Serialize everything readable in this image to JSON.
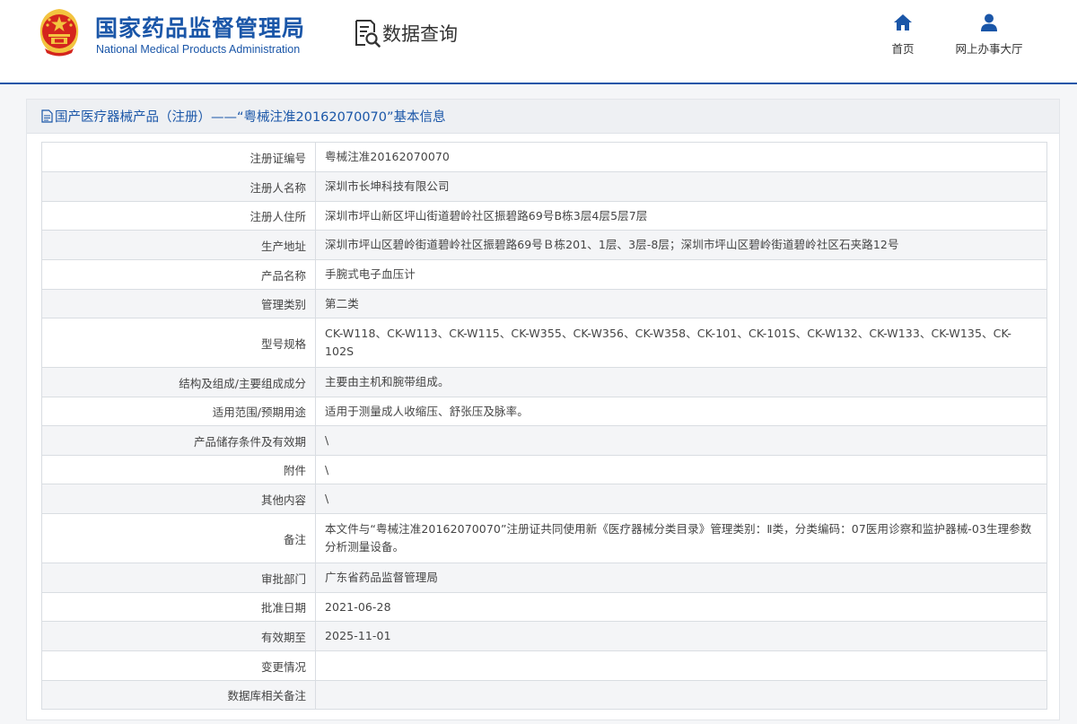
{
  "header": {
    "org_name_cn": "国家药品监督管理局",
    "org_name_en": "National Medical Products Administration",
    "query_label": "数据查询",
    "nav": [
      {
        "label": "首页",
        "icon": "home-icon"
      },
      {
        "label": "网上办事大厅",
        "icon": "user-icon"
      }
    ]
  },
  "panel": {
    "title": "国产医疗器械产品（注册）——“粤械注准20162070070”基本信息",
    "title_icon": "document-icon"
  },
  "colors": {
    "brand": "#1a56a8",
    "emblem_red": "#d4251d",
    "emblem_gold": "#f3c43f"
  },
  "rows": [
    {
      "label": "注册证编号",
      "value": "粤械注准20162070070"
    },
    {
      "label": "注册人名称",
      "value": "深圳市长坤科技有限公司"
    },
    {
      "label": "注册人住所",
      "value": "深圳市坪山新区坪山街道碧岭社区振碧路69号B栋3层4层5层7层"
    },
    {
      "label": "生产地址",
      "value": "深圳市坪山区碧岭街道碧岭社区振碧路69号Ｂ栋201、1层、3层-8层；深圳市坪山区碧岭街道碧岭社区石夹路12号"
    },
    {
      "label": "产品名称",
      "value": "手腕式电子血压计"
    },
    {
      "label": "管理类别",
      "value": "第二类"
    },
    {
      "label": "型号规格",
      "value": "CK-W118、CK-W113、CK-W115、CK-W355、CK-W356、CK-W358、CK-101、CK-101S、CK-W132、CK-W133、CK-W135、CK-102S"
    },
    {
      "label": "结构及组成/主要组成成分",
      "value": "主要由主机和腕带组成。"
    },
    {
      "label": "适用范围/预期用途",
      "value": "适用于测量成人收缩压、舒张压及脉率。"
    },
    {
      "label": "产品储存条件及有效期",
      "value": "\\"
    },
    {
      "label": "附件",
      "value": "\\"
    },
    {
      "label": "其他内容",
      "value": "\\"
    },
    {
      "label": "备注",
      "value": "本文件与“粤械注准20162070070”注册证共同使用新《医疗器械分类目录》管理类别：Ⅱ类，分类编码：07医用诊察和监护器械-03生理参数分析测量设备。"
    },
    {
      "label": "审批部门",
      "value": "广东省药品监督管理局"
    },
    {
      "label": "批准日期",
      "value": "2021-06-28"
    },
    {
      "label": "有效期至",
      "value": "2025-11-01"
    },
    {
      "label": "变更情况",
      "value": ""
    },
    {
      "label": "数据库相关备注",
      "value": ""
    }
  ]
}
